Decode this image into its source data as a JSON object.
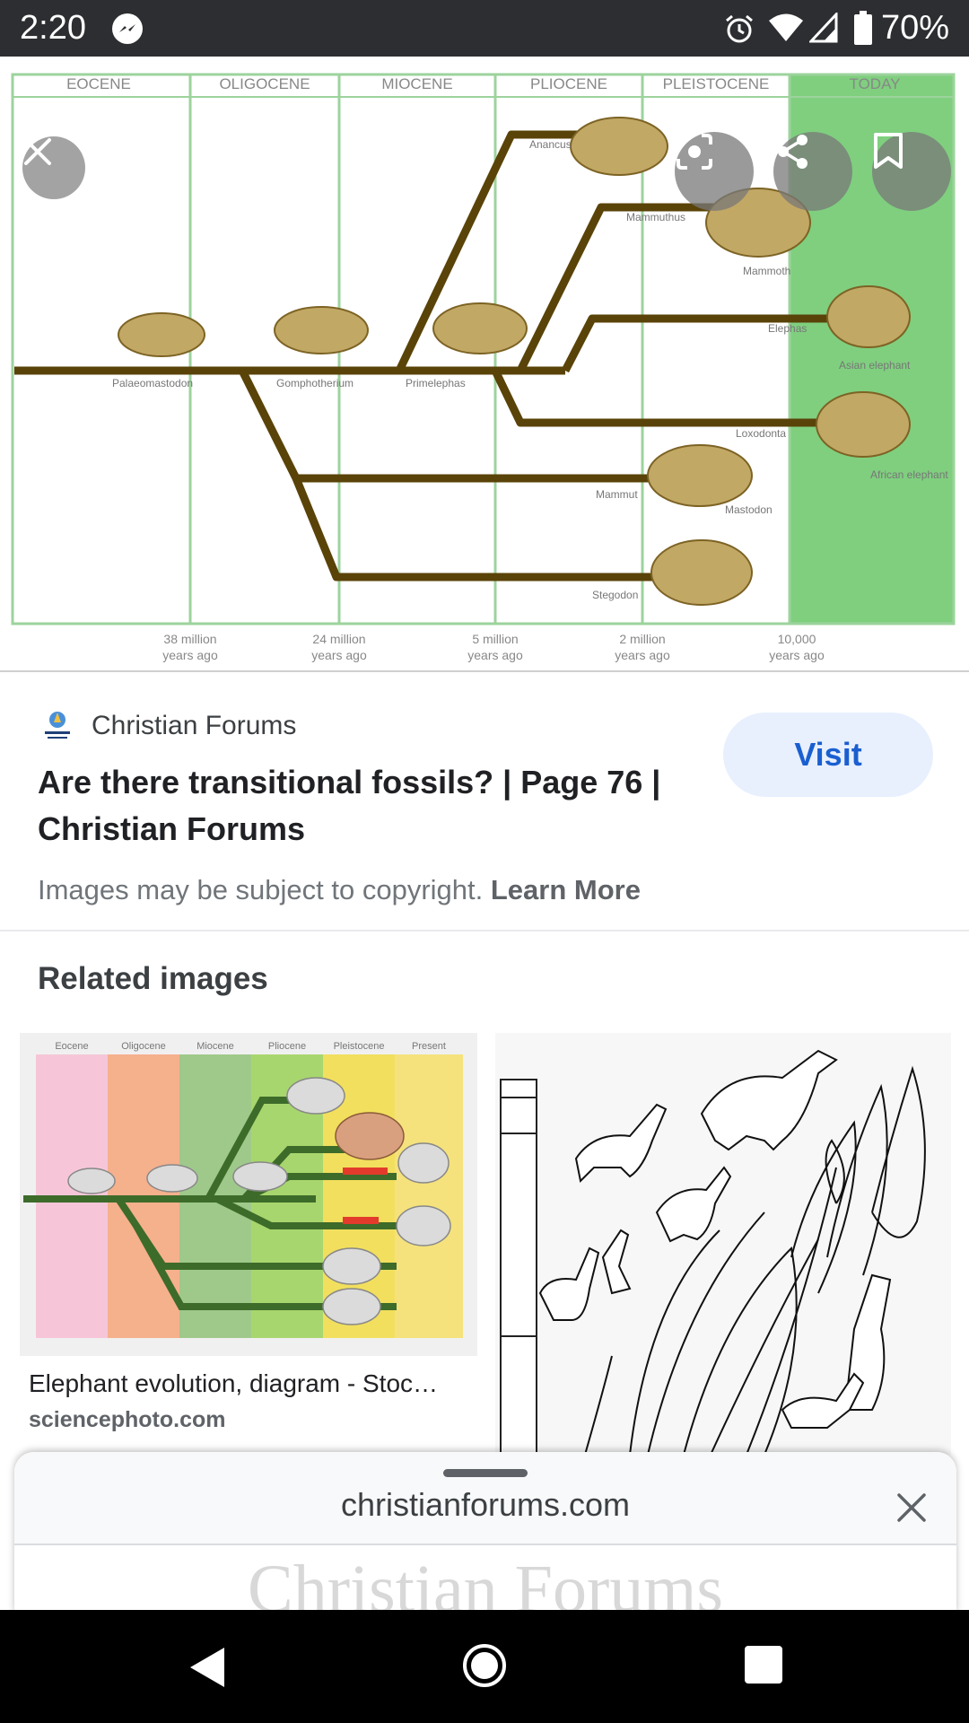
{
  "status_bar": {
    "time": "2:20",
    "battery_percent": "70%",
    "icons": [
      "messenger-icon",
      "alarm-icon",
      "wifi-icon",
      "signal-icon",
      "battery-icon"
    ]
  },
  "viewer": {
    "figure": {
      "eras": [
        "EOCENE",
        "OLIGOCENE",
        "MIOCENE",
        "PLIOCENE",
        "PLEISTOCENE",
        "TODAY"
      ],
      "time_labels": [
        [
          "38 million",
          "years ago"
        ],
        [
          "24 million",
          "years ago"
        ],
        [
          "5 million",
          "years ago"
        ],
        [
          "2 million",
          "years ago"
        ],
        [
          "10,000",
          "years ago"
        ]
      ],
      "species": [
        "Palaeomastodon",
        "Gomphotherium",
        "Primelephas",
        "Anancus",
        "Mammuthus",
        "Mammoth",
        "Elephas",
        "Asian elephant",
        "Loxodonta",
        "African elephant",
        "Mammut",
        "Mastodon",
        "Stegodon"
      ]
    },
    "buttons": [
      "close-icon",
      "lens-icon",
      "share-icon",
      "bookmark-icon"
    ]
  },
  "source": {
    "site_name": "Christian Forums",
    "title": "Are there transitional fossils? | Page 76 | Christian Forums",
    "visit_label": "Visit",
    "copyright_text": "Images may be subject to copyright.",
    "learn_more": "Learn More"
  },
  "related": {
    "heading": "Related images",
    "items": [
      {
        "title": "Elephant evolution, diagram - Stoc…",
        "domain": "sciencephoto.com",
        "era_labels": [
          "Eocene",
          "Oligocene",
          "Miocene",
          "Pliocene",
          "Pleistocene",
          "Present"
        ]
      },
      {
        "title": "",
        "domain": ""
      }
    ]
  },
  "sheet": {
    "domain": "christianforums.com",
    "peek_text": "Christian Forums"
  },
  "colors": {
    "status_bar_bg": "#2d2e31",
    "visit_bg": "#e8f0fe",
    "visit_text": "#1a5fd0",
    "today_band": "#7fcf7f"
  }
}
